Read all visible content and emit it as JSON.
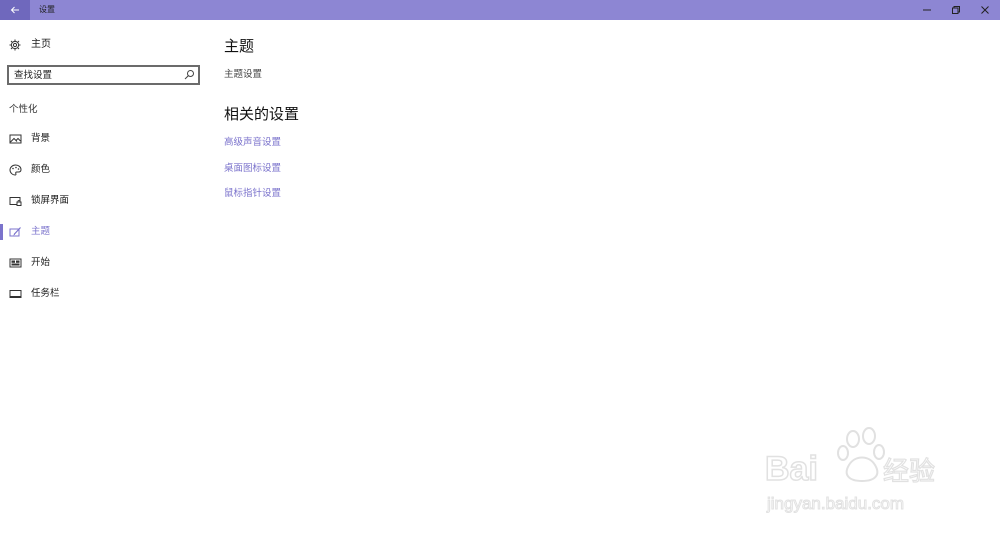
{
  "window": {
    "title": "设置",
    "back_icon": "arrow-left-icon",
    "controls": [
      "minimize-icon",
      "restore-icon",
      "close-icon"
    ],
    "titlebar_color": "#8d86d3"
  },
  "sidebar": {
    "home_label": "主页",
    "search_placeholder": "查找设置",
    "section_label": "个性化",
    "items": [
      {
        "label": "背景",
        "icon": "image-icon",
        "active": false
      },
      {
        "label": "颜色",
        "icon": "palette-icon",
        "active": false
      },
      {
        "label": "锁屏界面",
        "icon": "lock-screen-icon",
        "active": false
      },
      {
        "label": "主题",
        "icon": "theme-brush-icon",
        "active": true
      },
      {
        "label": "开始",
        "icon": "start-tiles-icon",
        "active": false
      },
      {
        "label": "任务栏",
        "icon": "taskbar-icon",
        "active": false
      }
    ],
    "accent_color": "#7b73cc"
  },
  "main": {
    "title": "主题",
    "subtitle": "主题设置",
    "related_heading": "相关的设置",
    "links": [
      "高级声音设置",
      "桌面图标设置",
      "鼠标指针设置"
    ]
  },
  "watermark": {
    "brand": "Baidu经验",
    "url": "jingyan.baidu.com"
  }
}
